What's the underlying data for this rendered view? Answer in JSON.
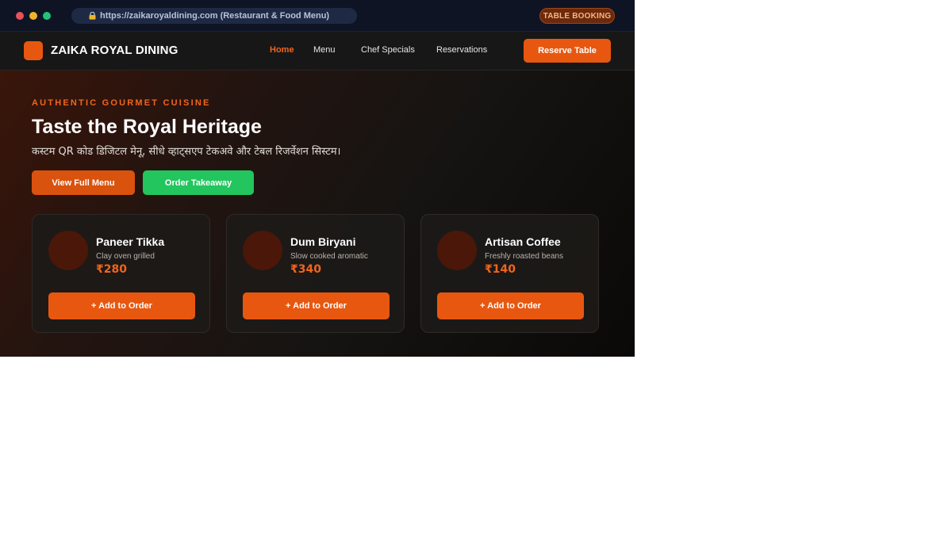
{
  "browser": {
    "url": "https://zaikaroyaldining.com (Restaurant & Food Menu)",
    "badge": "TABLE BOOKING"
  },
  "nav": {
    "brand": "ZAIKA ROYAL DINING",
    "links": [
      "Home",
      "Menu",
      "Chef Specials",
      "Reservations"
    ],
    "active": "Home",
    "cta": "Reserve Table"
  },
  "hero": {
    "eyebrow": "AUTHENTIC GOURMET CUISINE",
    "title": "Taste the Royal Heritage",
    "subtitle": "कस्टम QR कोड डिजिटल मेनू, सीधे व्हाट्सएप टेकअवे और टेबल रिजर्वेशन सिस्टम।",
    "buttons": {
      "menu": "View Full Menu",
      "takeaway": "Order Takeaway"
    }
  },
  "cards": [
    {
      "name": "Paneer Tikka",
      "desc": "Clay oven grilled",
      "price": "₹280",
      "button": "+ Add to Order"
    },
    {
      "name": "Dum Biryani",
      "desc": "Slow cooked aromatic",
      "price": "₹340",
      "button": "+ Add to Order"
    },
    {
      "name": "Artisan Coffee",
      "desc": "Freshly roasted beans",
      "price": "₹140",
      "button": "+ Add to Order"
    }
  ],
  "colors": {
    "accent": "#e8570f",
    "takeaway": "#22c55e",
    "chrome": "#0e1424"
  },
  "icons": {
    "lock": "lock-icon",
    "logo": "logo-mark"
  }
}
